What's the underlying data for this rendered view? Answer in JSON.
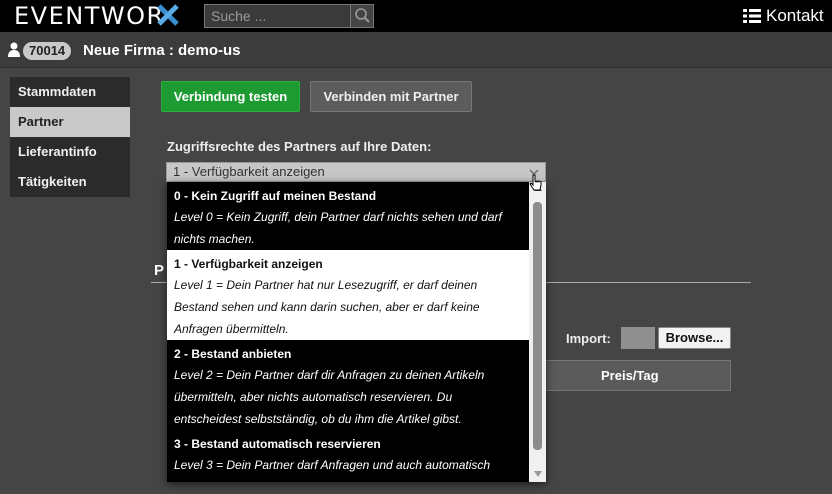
{
  "header": {
    "logo_text": "EVENTWOR",
    "search_placeholder": "Suche ...",
    "contact_label": "Kontakt"
  },
  "company": {
    "id": "70014",
    "name": "Neue Firma : demo-us"
  },
  "sidebar": {
    "items": [
      {
        "label": "Stammdaten",
        "active": false
      },
      {
        "label": "Partner",
        "active": true
      },
      {
        "label": "Lieferantinfo",
        "active": false
      },
      {
        "label": "Tätigkeiten",
        "active": false
      }
    ]
  },
  "main": {
    "test_connection_label": "Verbindung testen",
    "connect_partner_label": "Verbinden mit Partner",
    "access_rights_label": "Zugriffsrechte des Partners auf Ihre Daten:",
    "selected_value": "1 - Verfügbarkeit anzeigen",
    "section_title": "P",
    "import_label": "Import:",
    "browse_label": "Browse...",
    "table_header_price": "Preis/Tag"
  },
  "dropdown": {
    "options": [
      {
        "title": "0 - Kein Zugriff auf meinen Bestand",
        "desc_lines": [
          "Level 0 = Kein Zugriff, dein Partner darf nichts sehen und darf",
          "nichts machen."
        ]
      },
      {
        "title": "1 - Verfügbarkeit anzeigen",
        "desc_lines": [
          "Level 1 = Dein Partner hat nur Lesezugriff, er darf deinen",
          "Bestand sehen und kann darin suchen, aber er darf keine",
          "Anfragen übermitteln."
        ]
      },
      {
        "title": "2 - Bestand anbieten",
        "desc_lines": [
          "Level 2 = Dein Partner darf dir Anfragen zu deinen Artikeln",
          "übermitteln, aber nichts automatisch reservieren. Du",
          "entscheidest selbstständig, ob du ihm die Artikel gibst."
        ]
      },
      {
        "title": "3 - Bestand automatisch reservieren",
        "desc_lines": [
          "Level 3 = Dein Partner darf Anfragen und auch automatisch"
        ]
      }
    ]
  },
  "colors": {
    "accent_green": "#1e9a32",
    "logo_x_blue": "#3a8fd0"
  }
}
